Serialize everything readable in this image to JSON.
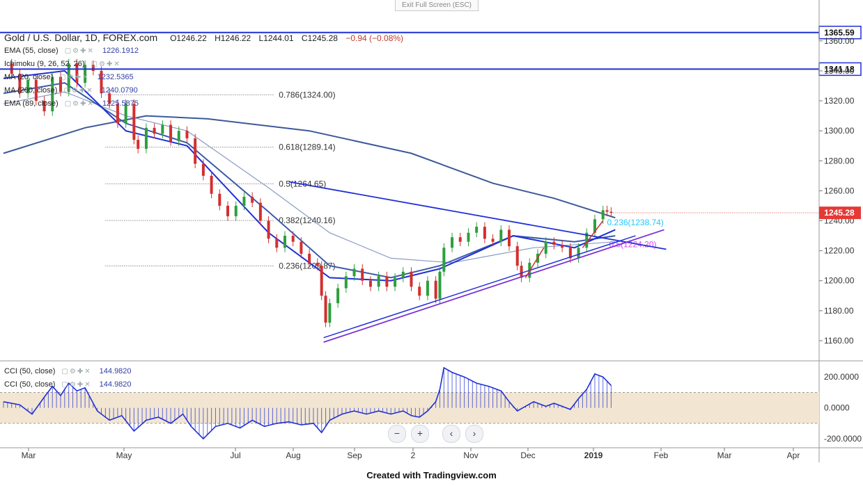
{
  "header": {
    "exit_label": "Exit Full Screen (ESC)",
    "symbol": "Gold / U.S. Dollar, 1D, FOREX.com",
    "open": "O1246.22",
    "high": "H1246.22",
    "low": "L1244.01",
    "close": "C1245.28",
    "change": "−0.94 (−0.08%)"
  },
  "indicators": [
    {
      "label": "EMA (55, close)",
      "value": "1226.1912"
    },
    {
      "label": "Ichimoku (9, 26, 52, 26)",
      "value": ""
    },
    {
      "label": "MA (20, close)",
      "value": "1232.5365"
    },
    {
      "label": "MA (200, close)",
      "value": "1240.0790"
    },
    {
      "label": "EMA (89, close)",
      "value": "1225.5875"
    }
  ],
  "cci_panel": {
    "rows": [
      {
        "label": "CCI (50, close)",
        "value": "144.9820"
      },
      {
        "label": "CCI (50, close)",
        "value": "144.9820"
      }
    ],
    "ticks": [
      "200.0000",
      "0.0000",
      "-200.0000"
    ]
  },
  "nav": {
    "zoom_out": "−",
    "zoom_in": "+",
    "prev": "‹",
    "next": "›"
  },
  "footer": "Created with Tradingview.com",
  "colors": {
    "up": "#2e9e3e",
    "down": "#d32f2f",
    "line_blue": "#1f2fd6",
    "ma_slate": "#3b5998",
    "purple": "#7b2fd6",
    "magenta": "#e040fb",
    "cyan": "#1ec8ff",
    "price_tag": "#e53935",
    "cci_band": "#f2e6d2"
  },
  "chart_data": {
    "type": "candlestick",
    "title": "Gold / U.S. Dollar, 1D, FOREX.com",
    "x_ticks": [
      "Mar",
      "May",
      "Jul",
      "Aug",
      "Sep",
      "2",
      "Nov",
      "Dec",
      "2019",
      "Feb",
      "Mar",
      "Apr"
    ],
    "y_ticks": [
      1160,
      1180,
      1200,
      1220,
      1240,
      1260,
      1280,
      1300,
      1320,
      1340,
      1360
    ],
    "ylim": [
      1147,
      1378
    ],
    "last_price": "1245.28",
    "horizontal_levels": [
      {
        "label": "1365.59",
        "value": 1365.59
      },
      {
        "label": "1341.18",
        "value": 1341.18
      }
    ],
    "fibonacci": [
      {
        "label": "0.786(1324.00)",
        "value": 1324.0
      },
      {
        "label": "0.618(1289.14)",
        "value": 1289.14
      },
      {
        "label": "0.5(1264.65)",
        "value": 1264.65
      },
      {
        "label": "0.382(1240.16)",
        "value": 1240.16
      },
      {
        "label": "0.236(1209.87)",
        "value": 1209.87
      }
    ],
    "fib_right": [
      {
        "label": "0.236(1238.74)",
        "value": 1238.74
      },
      {
        "label": "0.5(1224.20)",
        "value": 1224.2
      }
    ],
    "price_path": [
      [
        0,
        1345
      ],
      [
        4,
        1338
      ],
      [
        8,
        1325
      ],
      [
        12,
        1334
      ],
      [
        16,
        1320
      ],
      [
        20,
        1313
      ],
      [
        24,
        1336
      ],
      [
        28,
        1326
      ],
      [
        32,
        1345
      ],
      [
        36,
        1332
      ],
      [
        40,
        1344
      ],
      [
        44,
        1340
      ],
      [
        48,
        1325
      ],
      [
        52,
        1318
      ],
      [
        56,
        1305
      ],
      [
        60,
        1318
      ],
      [
        64,
        1294
      ],
      [
        66,
        1288
      ],
      [
        70,
        1302
      ],
      [
        74,
        1298
      ],
      [
        78,
        1304
      ],
      [
        82,
        1293
      ],
      [
        86,
        1300
      ],
      [
        90,
        1295
      ],
      [
        94,
        1278
      ],
      [
        98,
        1270
      ],
      [
        102,
        1258
      ],
      [
        106,
        1250
      ],
      [
        110,
        1243
      ],
      [
        114,
        1250
      ],
      [
        118,
        1256
      ],
      [
        122,
        1252
      ],
      [
        126,
        1240
      ],
      [
        130,
        1228
      ],
      [
        134,
        1222
      ],
      [
        138,
        1230
      ],
      [
        142,
        1226
      ],
      [
        146,
        1218
      ],
      [
        150,
        1212
      ],
      [
        154,
        1210
      ],
      [
        156,
        1190
      ],
      [
        158,
        1172
      ],
      [
        160,
        1185
      ],
      [
        164,
        1195
      ],
      [
        168,
        1203
      ],
      [
        172,
        1208
      ],
      [
        176,
        1200
      ],
      [
        180,
        1196
      ],
      [
        184,
        1203
      ],
      [
        188,
        1196
      ],
      [
        192,
        1202
      ],
      [
        196,
        1206
      ],
      [
        200,
        1196
      ],
      [
        204,
        1190
      ],
      [
        208,
        1200
      ],
      [
        212,
        1188
      ],
      [
        214,
        1206
      ],
      [
        216,
        1222
      ],
      [
        220,
        1229
      ],
      [
        224,
        1226
      ],
      [
        228,
        1232
      ],
      [
        232,
        1236
      ],
      [
        236,
        1228
      ],
      [
        240,
        1226
      ],
      [
        244,
        1234
      ],
      [
        248,
        1223
      ],
      [
        252,
        1210
      ],
      [
        254,
        1202
      ],
      [
        258,
        1212
      ],
      [
        262,
        1218
      ],
      [
        266,
        1226
      ],
      [
        270,
        1224
      ],
      [
        274,
        1222
      ],
      [
        278,
        1215
      ],
      [
        282,
        1222
      ],
      [
        286,
        1232
      ],
      [
        290,
        1241
      ],
      [
        294,
        1247
      ],
      [
        296,
        1246
      ],
      [
        298,
        1245.28
      ]
    ],
    "ema_55": [
      [
        0,
        1325
      ],
      [
        30,
        1332
      ],
      [
        60,
        1305
      ],
      [
        90,
        1292
      ],
      [
        130,
        1246
      ],
      [
        160,
        1210
      ],
      [
        190,
        1202
      ],
      [
        214,
        1210
      ],
      [
        250,
        1230
      ],
      [
        280,
        1226
      ],
      [
        300,
        1230
      ]
    ],
    "ma_20": [
      [
        0,
        1335
      ],
      [
        30,
        1340
      ],
      [
        60,
        1300
      ],
      [
        90,
        1290
      ],
      [
        130,
        1232
      ],
      [
        160,
        1202
      ],
      [
        190,
        1200
      ],
      [
        214,
        1208
      ],
      [
        250,
        1230
      ],
      [
        280,
        1222
      ],
      [
        300,
        1234
      ]
    ],
    "ma_200": [
      [
        0,
        1285
      ],
      [
        40,
        1302
      ],
      [
        70,
        1310
      ],
      [
        100,
        1308
      ],
      [
        150,
        1300
      ],
      [
        200,
        1285
      ],
      [
        240,
        1265
      ],
      [
        270,
        1255
      ],
      [
        300,
        1242
      ]
    ],
    "ema_89": [
      [
        0,
        1318
      ],
      [
        30,
        1326
      ],
      [
        60,
        1310
      ],
      [
        90,
        1300
      ],
      [
        130,
        1262
      ],
      [
        160,
        1232
      ],
      [
        190,
        1215
      ],
      [
        220,
        1212
      ],
      [
        260,
        1222
      ],
      [
        300,
        1226
      ]
    ],
    "cci_ylim": [
      -240,
      300
    ],
    "cci": [
      [
        0,
        40
      ],
      [
        8,
        20
      ],
      [
        14,
        -40
      ],
      [
        20,
        70
      ],
      [
        24,
        140
      ],
      [
        28,
        80
      ],
      [
        32,
        160
      ],
      [
        36,
        110
      ],
      [
        40,
        130
      ],
      [
        46,
        -20
      ],
      [
        52,
        -80
      ],
      [
        58,
        -50
      ],
      [
        64,
        -150
      ],
      [
        70,
        -80
      ],
      [
        76,
        -60
      ],
      [
        82,
        -100
      ],
      [
        88,
        -40
      ],
      [
        92,
        -120
      ],
      [
        98,
        -200
      ],
      [
        104,
        -120
      ],
      [
        110,
        -100
      ],
      [
        116,
        -130
      ],
      [
        122,
        -80
      ],
      [
        128,
        -120
      ],
      [
        134,
        -100
      ],
      [
        140,
        -90
      ],
      [
        146,
        -110
      ],
      [
        152,
        -100
      ],
      [
        156,
        -160
      ],
      [
        160,
        -80
      ],
      [
        166,
        -40
      ],
      [
        172,
        -20
      ],
      [
        178,
        -40
      ],
      [
        184,
        -20
      ],
      [
        190,
        -40
      ],
      [
        196,
        -20
      ],
      [
        200,
        -50
      ],
      [
        204,
        -60
      ],
      [
        208,
        -20
      ],
      [
        212,
        40
      ],
      [
        214,
        120
      ],
      [
        216,
        260
      ],
      [
        220,
        230
      ],
      [
        226,
        200
      ],
      [
        232,
        160
      ],
      [
        238,
        140
      ],
      [
        244,
        110
      ],
      [
        248,
        40
      ],
      [
        252,
        -20
      ],
      [
        256,
        10
      ],
      [
        260,
        40
      ],
      [
        266,
        10
      ],
      [
        270,
        30
      ],
      [
        274,
        10
      ],
      [
        278,
        -10
      ],
      [
        282,
        60
      ],
      [
        286,
        120
      ],
      [
        290,
        220
      ],
      [
        294,
        200
      ],
      [
        298,
        145
      ]
    ],
    "xlim": [
      0,
      400
    ]
  }
}
